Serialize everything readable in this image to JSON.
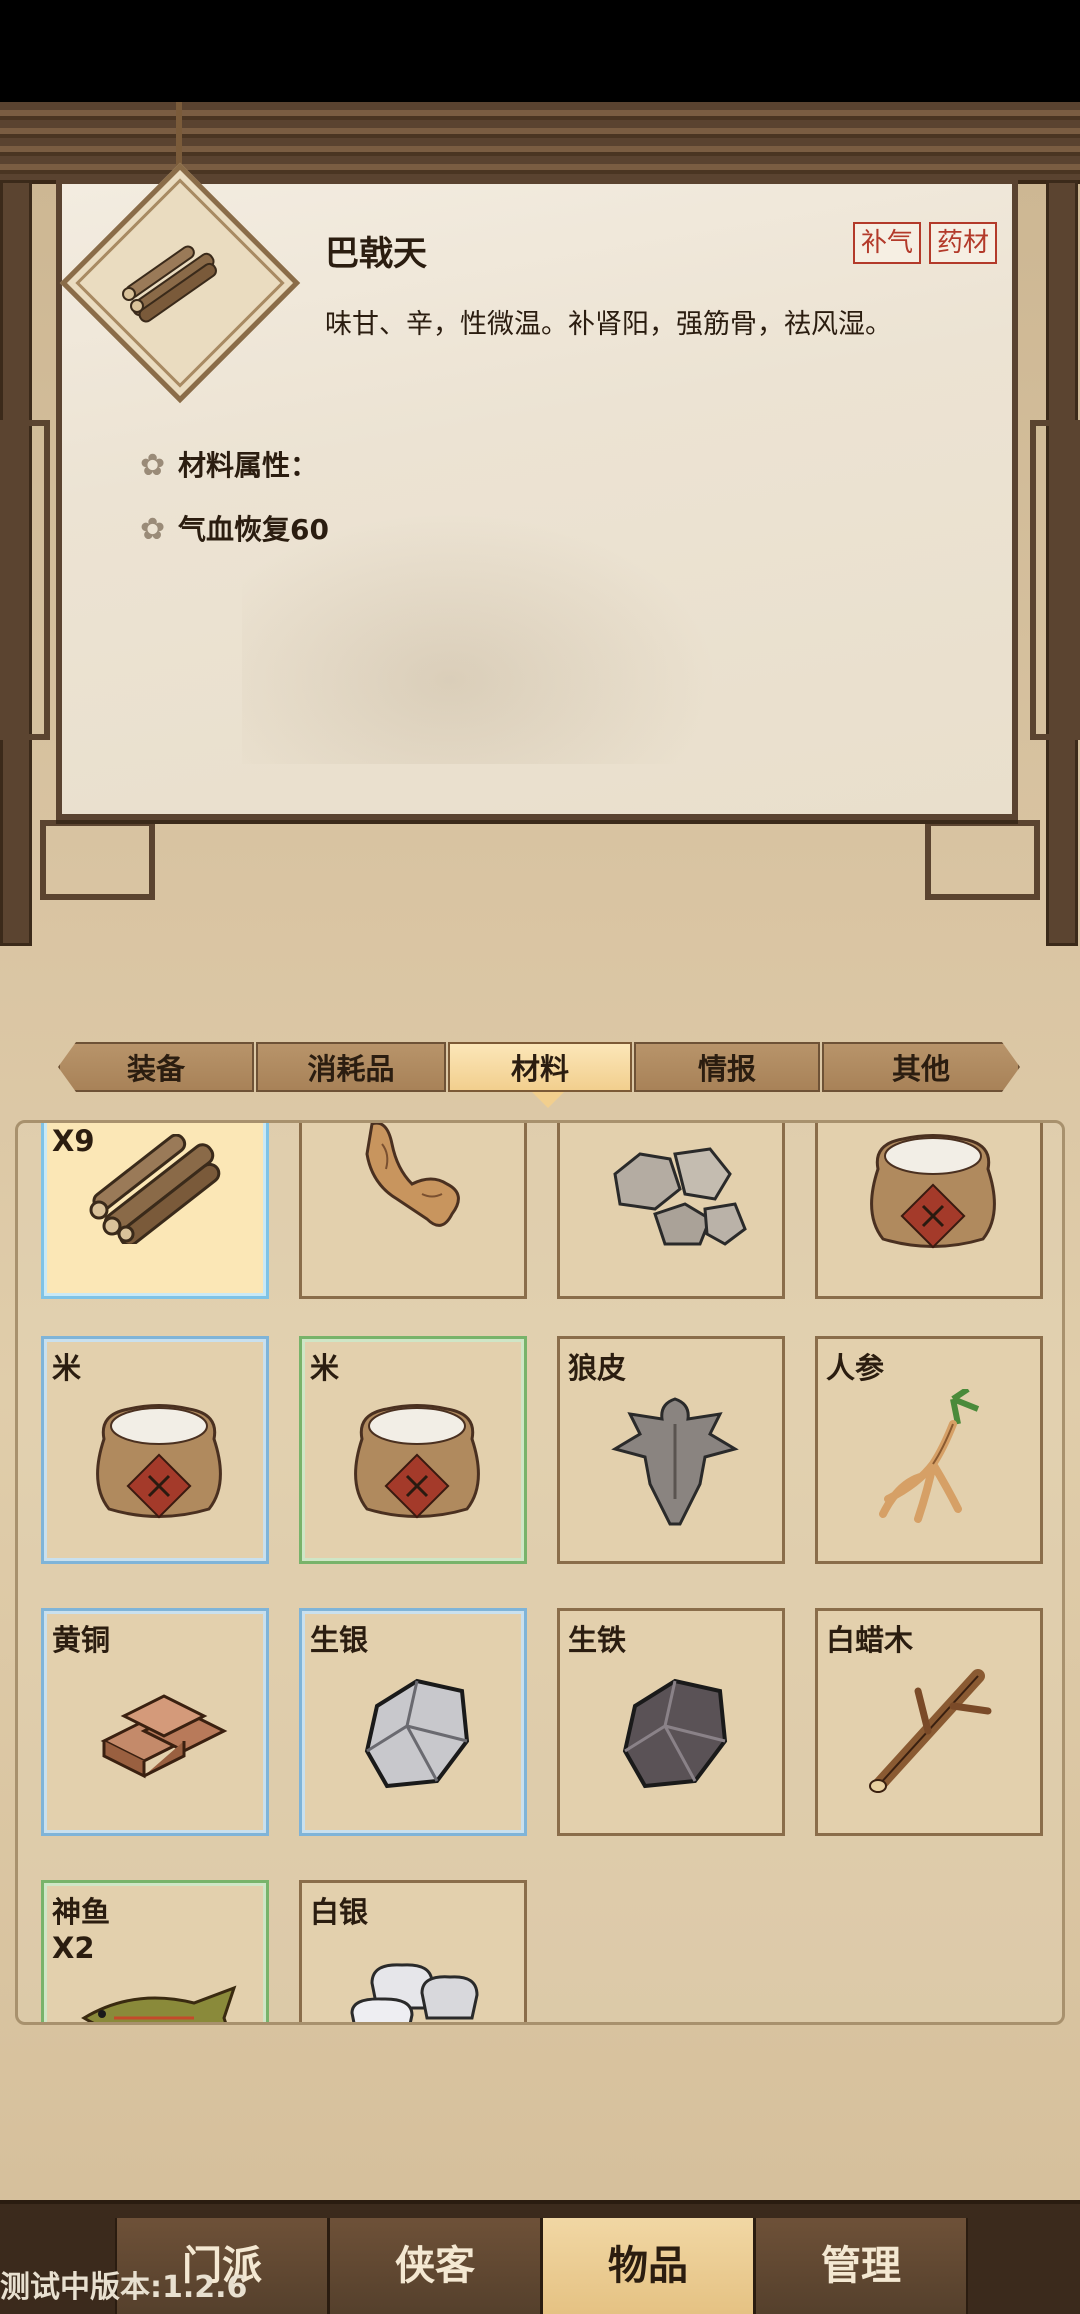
{
  "detail": {
    "title": "巴戟天",
    "tags": [
      "补气",
      "药材"
    ],
    "description": "味甘、辛，性微温。补肾阳，强筋骨，祛风湿。",
    "attr_header": "材料属性：",
    "attributes": [
      "气血恢复60"
    ],
    "icon": "bajitian-root-icon"
  },
  "tabs": [
    {
      "label": "装备",
      "active": false
    },
    {
      "label": "消耗品",
      "active": false
    },
    {
      "label": "材料",
      "active": true
    },
    {
      "label": "情报",
      "active": false
    },
    {
      "label": "其他",
      "active": false
    }
  ],
  "items": [
    {
      "name": "",
      "count": "X9",
      "icon": "bajitian-root-icon",
      "frame": "selected"
    },
    {
      "name": "",
      "count": "",
      "icon": "ginger-root-icon",
      "frame": "plain"
    },
    {
      "name": "",
      "count": "",
      "icon": "stones-icon",
      "frame": "plain"
    },
    {
      "name": "",
      "count": "",
      "icon": "rice-sack-icon",
      "frame": "plain"
    },
    {
      "name": "米",
      "count": "",
      "icon": "rice-sack-icon",
      "frame": "blue"
    },
    {
      "name": "米",
      "count": "",
      "icon": "rice-sack-icon",
      "frame": "green"
    },
    {
      "name": "狼皮",
      "count": "",
      "icon": "wolf-pelt-icon",
      "frame": "plain"
    },
    {
      "name": "人参",
      "count": "",
      "icon": "ginseng-icon",
      "frame": "plain"
    },
    {
      "name": "黄铜",
      "count": "",
      "icon": "brass-ingots-icon",
      "frame": "blue"
    },
    {
      "name": "生银",
      "count": "",
      "icon": "raw-silver-ore-icon",
      "frame": "blue"
    },
    {
      "name": "生铁",
      "count": "",
      "icon": "raw-iron-ore-icon",
      "frame": "plain"
    },
    {
      "name": "白蜡木",
      "count": "",
      "icon": "ash-wood-branch-icon",
      "frame": "plain"
    },
    {
      "name": "神鱼",
      "count": "X2",
      "icon": "arowana-fish-icon",
      "frame": "green"
    },
    {
      "name": "白银",
      "count": "",
      "icon": "silver-ingots-icon",
      "frame": "plain"
    }
  ],
  "nav": [
    {
      "label": "门派",
      "active": false
    },
    {
      "label": "侠客",
      "active": false
    },
    {
      "label": "物品",
      "active": true
    },
    {
      "label": "管理",
      "active": false
    }
  ],
  "version_text": "测试中版本:1.2.6"
}
